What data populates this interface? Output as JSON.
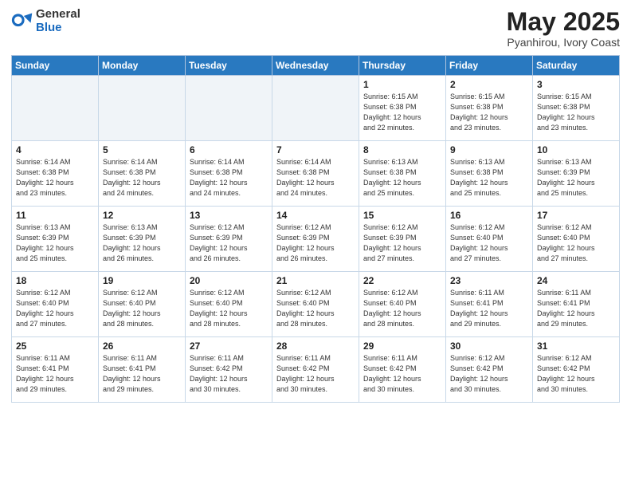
{
  "header": {
    "logo_general": "General",
    "logo_blue": "Blue",
    "title": "May 2025",
    "subtitle": "Pyanhirou, Ivory Coast"
  },
  "weekdays": [
    "Sunday",
    "Monday",
    "Tuesday",
    "Wednesday",
    "Thursday",
    "Friday",
    "Saturday"
  ],
  "weeks": [
    [
      {
        "day": "",
        "info": "",
        "shaded": true
      },
      {
        "day": "",
        "info": "",
        "shaded": true
      },
      {
        "day": "",
        "info": "",
        "shaded": true
      },
      {
        "day": "",
        "info": "",
        "shaded": true
      },
      {
        "day": "1",
        "info": "Sunrise: 6:15 AM\nSunset: 6:38 PM\nDaylight: 12 hours\nand 22 minutes."
      },
      {
        "day": "2",
        "info": "Sunrise: 6:15 AM\nSunset: 6:38 PM\nDaylight: 12 hours\nand 23 minutes."
      },
      {
        "day": "3",
        "info": "Sunrise: 6:15 AM\nSunset: 6:38 PM\nDaylight: 12 hours\nand 23 minutes."
      }
    ],
    [
      {
        "day": "4",
        "info": "Sunrise: 6:14 AM\nSunset: 6:38 PM\nDaylight: 12 hours\nand 23 minutes."
      },
      {
        "day": "5",
        "info": "Sunrise: 6:14 AM\nSunset: 6:38 PM\nDaylight: 12 hours\nand 24 minutes."
      },
      {
        "day": "6",
        "info": "Sunrise: 6:14 AM\nSunset: 6:38 PM\nDaylight: 12 hours\nand 24 minutes."
      },
      {
        "day": "7",
        "info": "Sunrise: 6:14 AM\nSunset: 6:38 PM\nDaylight: 12 hours\nand 24 minutes."
      },
      {
        "day": "8",
        "info": "Sunrise: 6:13 AM\nSunset: 6:38 PM\nDaylight: 12 hours\nand 25 minutes."
      },
      {
        "day": "9",
        "info": "Sunrise: 6:13 AM\nSunset: 6:38 PM\nDaylight: 12 hours\nand 25 minutes."
      },
      {
        "day": "10",
        "info": "Sunrise: 6:13 AM\nSunset: 6:39 PM\nDaylight: 12 hours\nand 25 minutes."
      }
    ],
    [
      {
        "day": "11",
        "info": "Sunrise: 6:13 AM\nSunset: 6:39 PM\nDaylight: 12 hours\nand 25 minutes."
      },
      {
        "day": "12",
        "info": "Sunrise: 6:13 AM\nSunset: 6:39 PM\nDaylight: 12 hours\nand 26 minutes."
      },
      {
        "day": "13",
        "info": "Sunrise: 6:12 AM\nSunset: 6:39 PM\nDaylight: 12 hours\nand 26 minutes."
      },
      {
        "day": "14",
        "info": "Sunrise: 6:12 AM\nSunset: 6:39 PM\nDaylight: 12 hours\nand 26 minutes."
      },
      {
        "day": "15",
        "info": "Sunrise: 6:12 AM\nSunset: 6:39 PM\nDaylight: 12 hours\nand 27 minutes."
      },
      {
        "day": "16",
        "info": "Sunrise: 6:12 AM\nSunset: 6:40 PM\nDaylight: 12 hours\nand 27 minutes."
      },
      {
        "day": "17",
        "info": "Sunrise: 6:12 AM\nSunset: 6:40 PM\nDaylight: 12 hours\nand 27 minutes."
      }
    ],
    [
      {
        "day": "18",
        "info": "Sunrise: 6:12 AM\nSunset: 6:40 PM\nDaylight: 12 hours\nand 27 minutes."
      },
      {
        "day": "19",
        "info": "Sunrise: 6:12 AM\nSunset: 6:40 PM\nDaylight: 12 hours\nand 28 minutes."
      },
      {
        "day": "20",
        "info": "Sunrise: 6:12 AM\nSunset: 6:40 PM\nDaylight: 12 hours\nand 28 minutes."
      },
      {
        "day": "21",
        "info": "Sunrise: 6:12 AM\nSunset: 6:40 PM\nDaylight: 12 hours\nand 28 minutes."
      },
      {
        "day": "22",
        "info": "Sunrise: 6:12 AM\nSunset: 6:40 PM\nDaylight: 12 hours\nand 28 minutes."
      },
      {
        "day": "23",
        "info": "Sunrise: 6:11 AM\nSunset: 6:41 PM\nDaylight: 12 hours\nand 29 minutes."
      },
      {
        "day": "24",
        "info": "Sunrise: 6:11 AM\nSunset: 6:41 PM\nDaylight: 12 hours\nand 29 minutes."
      }
    ],
    [
      {
        "day": "25",
        "info": "Sunrise: 6:11 AM\nSunset: 6:41 PM\nDaylight: 12 hours\nand 29 minutes."
      },
      {
        "day": "26",
        "info": "Sunrise: 6:11 AM\nSunset: 6:41 PM\nDaylight: 12 hours\nand 29 minutes."
      },
      {
        "day": "27",
        "info": "Sunrise: 6:11 AM\nSunset: 6:42 PM\nDaylight: 12 hours\nand 30 minutes."
      },
      {
        "day": "28",
        "info": "Sunrise: 6:11 AM\nSunset: 6:42 PM\nDaylight: 12 hours\nand 30 minutes."
      },
      {
        "day": "29",
        "info": "Sunrise: 6:11 AM\nSunset: 6:42 PM\nDaylight: 12 hours\nand 30 minutes."
      },
      {
        "day": "30",
        "info": "Sunrise: 6:12 AM\nSunset: 6:42 PM\nDaylight: 12 hours\nand 30 minutes."
      },
      {
        "day": "31",
        "info": "Sunrise: 6:12 AM\nSunset: 6:42 PM\nDaylight: 12 hours\nand 30 minutes."
      }
    ]
  ]
}
